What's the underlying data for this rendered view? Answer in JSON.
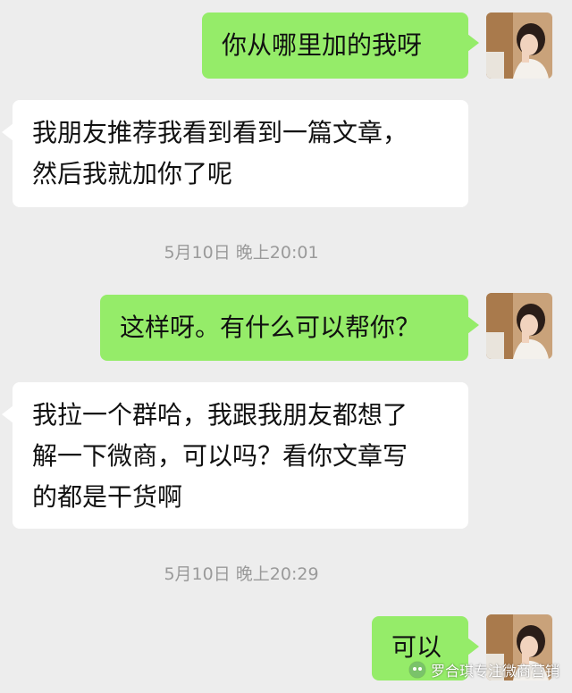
{
  "messages": [
    {
      "side": "out",
      "text": "你从哪里加的我呀"
    },
    {
      "side": "in",
      "lines": [
        "我朋友推荐我看到看到一篇文章，",
        "然后我就加你了呢"
      ]
    },
    {
      "side": "time",
      "text": "5月10日 晚上20:01"
    },
    {
      "side": "out",
      "text": "这样呀。有什么可以帮你？"
    },
    {
      "side": "in",
      "lines": [
        "我拉一个群哈，我跟我朋友都想了",
        "解一下微商，可以吗？看你文章写",
        "的都是干货啊"
      ]
    },
    {
      "side": "time",
      "text": "5月10日 晚上20:29"
    },
    {
      "side": "out",
      "text": "可以"
    }
  ],
  "watermark": {
    "text": "罗合琪专注微商营销",
    "icon": "wechat-official-account-icon"
  },
  "avatar": {
    "icon": "user-avatar-photo"
  },
  "colors": {
    "outgoing_bubble": "#95ec69",
    "incoming_bubble": "#ffffff",
    "background": "#ededed",
    "timestamp": "#9a9a9a"
  }
}
